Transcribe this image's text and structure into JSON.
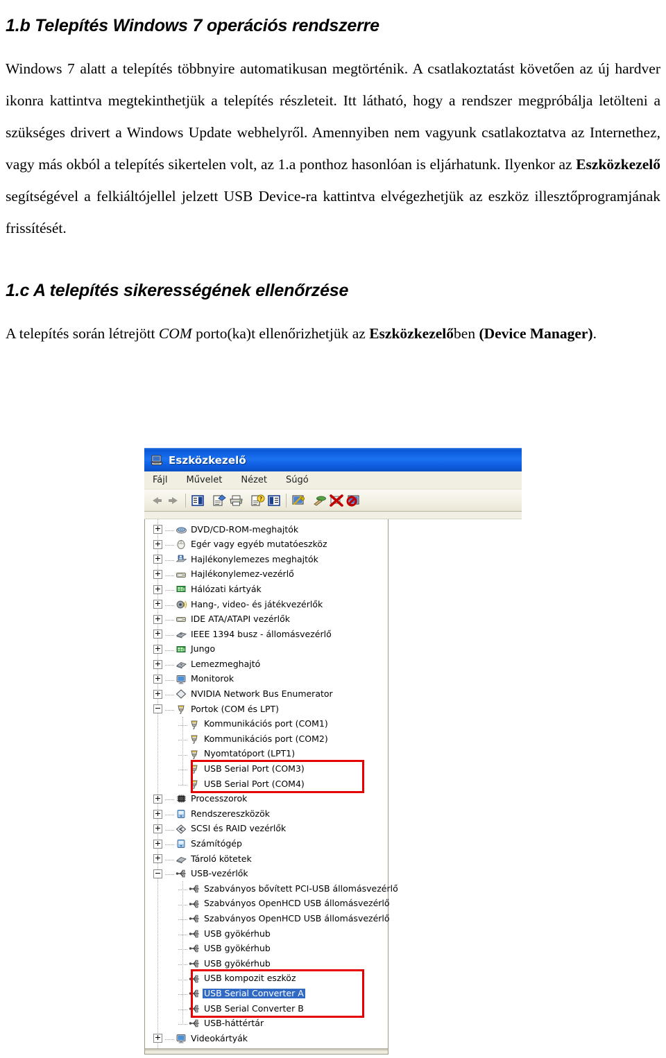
{
  "document": {
    "heading_1": "1.b Telepítés Windows 7 operációs rendszerre",
    "paragraph_1": {
      "seg_1": "Windows 7 alatt a telepítés többnyire automatikusan megtörténik. A csatlakoztatást követően az új hardver ikonra kattintva megtekinthetjük a telepítés részleteit. Itt látható, hogy a rendszer megpróbálja letölteni a szükséges drivert a Windows Update webhelyről. Amennyiben nem vagyunk csatlakoztatva az Internethez, vagy más okból a telepítés sikertelen volt, az 1.a ponthoz hasonlóan is eljárhatunk. Ilyenkor az ",
      "seg_bold_1": "Eszközkezelő",
      "seg_2": " segítségével a felkiáltójellel jelzett USB Device-ra kattintva elvégezhetjük az eszköz illesztőprogramjának frissítését."
    },
    "heading_2": "1.c A telepítés sikerességének ellenőrzése",
    "paragraph_2": {
      "seg_1": "A telepítés során létrejött ",
      "seg_italic_1": "COM",
      "seg_2": " porto(ka)t ellenőrizhetjük az ",
      "seg_bold_1": "Eszközkezelő",
      "seg_3": "ben ",
      "seg_bold_2": "(Device Manager)",
      "seg_4": "."
    }
  },
  "device_manager": {
    "title": "Eszközkezelő",
    "title_icon": "computer-icon",
    "menu": [
      {
        "label": "Fájl",
        "name": "menu-file"
      },
      {
        "label": "Művelet",
        "name": "menu-action"
      },
      {
        "label": "Nézet",
        "name": "menu-view"
      },
      {
        "label": "Súgó",
        "name": "menu-help"
      }
    ],
    "toolbar": [
      {
        "name": "back-arrow-icon",
        "kind": "arrow-left"
      },
      {
        "name": "forward-arrow-icon",
        "kind": "arrow-right"
      },
      {
        "name": "show-hide-console-tree-icon",
        "kind": "console-tree"
      },
      {
        "name": "properties-icon",
        "kind": "properties"
      },
      {
        "name": "print-icon",
        "kind": "print"
      },
      {
        "name": "help-icon",
        "kind": "help"
      },
      {
        "name": "show-hide-action-pane-icon",
        "kind": "action-pane"
      },
      {
        "name": "scan-hardware-changes-icon",
        "kind": "scan"
      },
      {
        "name": "update-driver-icon",
        "kind": "update-driver"
      },
      {
        "name": "disable-device-icon",
        "kind": "disable"
      },
      {
        "name": "uninstall-device-icon",
        "kind": "uninstall"
      }
    ],
    "selection_color": "#316ac5",
    "highlight_color": "#e60000",
    "tree": [
      {
        "label": "DVD/CD-ROM-meghajtók",
        "level": 1,
        "expander": "plus",
        "icon": "cdrom-icon"
      },
      {
        "label": "Egér vagy egyéb mutatóeszköz",
        "level": 1,
        "expander": "plus",
        "icon": "mouse-icon"
      },
      {
        "label": "Hajlékonylemezes meghajtók",
        "level": 1,
        "expander": "plus",
        "icon": "floppy-drive-icon"
      },
      {
        "label": "Hajlékonylemez-vezérlő",
        "level": 1,
        "expander": "plus",
        "icon": "floppy-controller-icon"
      },
      {
        "label": "Hálózati kártyák",
        "level": 1,
        "expander": "plus",
        "icon": "network-card-icon"
      },
      {
        "label": "Hang-, video- és játékvezérlők",
        "level": 1,
        "expander": "plus",
        "icon": "sound-icon"
      },
      {
        "label": "IDE ATA/ATAPI vezérlők",
        "level": 1,
        "expander": "plus",
        "icon": "ide-controller-icon"
      },
      {
        "label": "IEEE 1394 busz - állomásvezérlő",
        "level": 1,
        "expander": "plus",
        "icon": "ieee1394-icon"
      },
      {
        "label": "Jungo",
        "level": 1,
        "expander": "plus",
        "icon": "network-card-icon"
      },
      {
        "label": "Lemezmeghajtó",
        "level": 1,
        "expander": "plus",
        "icon": "disk-drive-icon"
      },
      {
        "label": "Monitorok",
        "level": 1,
        "expander": "plus",
        "icon": "monitor-icon"
      },
      {
        "label": "NVIDIA Network Bus Enumerator",
        "level": 1,
        "expander": "plus",
        "icon": "bus-enumerator-icon"
      },
      {
        "label": "Portok (COM és LPT)",
        "level": 1,
        "expander": "minus",
        "icon": "port-icon"
      },
      {
        "label": "Kommunikációs port (COM1)",
        "level": 2,
        "expander": "none",
        "icon": "port-icon"
      },
      {
        "label": "Kommunikációs port (COM2)",
        "level": 2,
        "expander": "none",
        "icon": "port-icon"
      },
      {
        "label": "Nyomtatóport (LPT1)",
        "level": 2,
        "expander": "none",
        "icon": "port-icon"
      },
      {
        "label": "USB Serial Port (COM3)",
        "level": 2,
        "expander": "none",
        "icon": "port-icon"
      },
      {
        "label": "USB Serial Port (COM4)",
        "level": 2,
        "expander": "none",
        "icon": "port-icon"
      },
      {
        "label": "Processzorok",
        "level": 1,
        "expander": "plus",
        "icon": "cpu-icon"
      },
      {
        "label": "Rendszereszközök",
        "level": 1,
        "expander": "plus",
        "icon": "system-device-icon"
      },
      {
        "label": "SCSI és RAID vezérlők",
        "level": 1,
        "expander": "plus",
        "icon": "scsi-icon"
      },
      {
        "label": "Számítógép",
        "level": 1,
        "expander": "plus",
        "icon": "computer-node-icon"
      },
      {
        "label": "Tároló kötetek",
        "level": 1,
        "expander": "plus",
        "icon": "storage-volume-icon"
      },
      {
        "label": "USB-vezérlők",
        "level": 1,
        "expander": "minus",
        "icon": "usb-icon"
      },
      {
        "label": "Szabványos bővített PCI-USB állomásvezérlő",
        "level": 2,
        "expander": "none",
        "icon": "usb-icon"
      },
      {
        "label": "Szabványos OpenHCD USB állomásvezérlő",
        "level": 2,
        "expander": "none",
        "icon": "usb-icon"
      },
      {
        "label": "Szabványos OpenHCD USB állomásvezérlő",
        "level": 2,
        "expander": "none",
        "icon": "usb-icon"
      },
      {
        "label": "USB gyökérhub",
        "level": 2,
        "expander": "none",
        "icon": "usb-icon"
      },
      {
        "label": "USB gyökérhub",
        "level": 2,
        "expander": "none",
        "icon": "usb-icon"
      },
      {
        "label": "USB gyökérhub",
        "level": 2,
        "expander": "none",
        "icon": "usb-icon"
      },
      {
        "label": "USB kompozit eszköz",
        "level": 2,
        "expander": "none",
        "icon": "usb-icon"
      },
      {
        "label": "USB Serial Converter A",
        "level": 2,
        "expander": "none",
        "icon": "usb-icon",
        "selected": true
      },
      {
        "label": "USB Serial Converter B",
        "level": 2,
        "expander": "none",
        "icon": "usb-icon"
      },
      {
        "label": "USB-háttértár",
        "level": 2,
        "expander": "none",
        "icon": "usb-icon"
      },
      {
        "label": "Videokártyák",
        "level": 1,
        "expander": "plus",
        "icon": "display-adapter-icon"
      }
    ],
    "highlight_boxes": [
      {
        "name": "highlight-usb-serial-ports",
        "from_index": 16,
        "to_index": 17
      },
      {
        "name": "highlight-usb-serial-converters",
        "from_index": 30,
        "to_index": 32
      }
    ]
  }
}
